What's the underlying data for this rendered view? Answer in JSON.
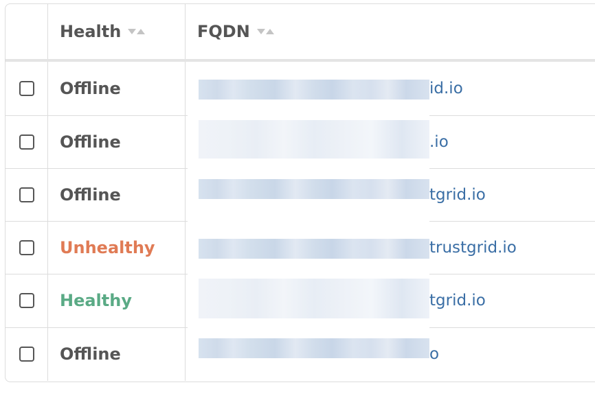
{
  "columns": {
    "health": "Health",
    "fqdn": "FQDN"
  },
  "rows": [
    {
      "health": "Offline",
      "health_color": "#555555",
      "fqdn_visible": "id.io"
    },
    {
      "health": "Offline",
      "health_color": "#555555",
      "fqdn_visible": ".io"
    },
    {
      "health": "Offline",
      "health_color": "#555555",
      "fqdn_visible": "tgrid.io"
    },
    {
      "health": "Unhealthy",
      "health_color": "#e07b55",
      "fqdn_visible": "trustgrid.io"
    },
    {
      "health": "Healthy",
      "health_color": "#5aaa85",
      "fqdn_visible": "tgrid.io"
    },
    {
      "health": "Offline",
      "health_color": "#555555",
      "fqdn_visible": "o"
    }
  ],
  "colors": {
    "link": "#3a6ea5",
    "border": "#dcdcdc",
    "text": "#555555"
  }
}
